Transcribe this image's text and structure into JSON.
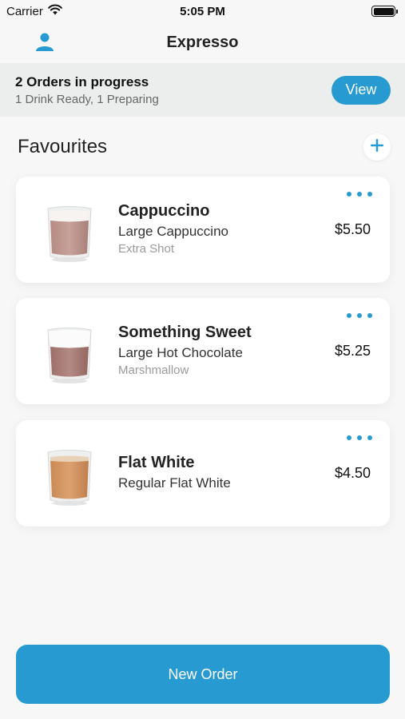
{
  "status_bar": {
    "carrier": "Carrier",
    "time": "5:05 PM"
  },
  "nav": {
    "title": "Expresso",
    "profile_icon": "person-icon"
  },
  "order_banner": {
    "title": "2 Orders in progress",
    "subtitle": "1 Drink Ready, 1 Preparing",
    "view_label": "View"
  },
  "favourites": {
    "title": "Favourites",
    "add_icon": "plus-icon",
    "items": [
      {
        "name": "Cappuccino",
        "description": "Large Cappuccino",
        "extra": "Extra Shot",
        "price": "$5.50",
        "cup": "cappuccino-cup-icon"
      },
      {
        "name": "Something Sweet",
        "description": "Large Hot Chocolate",
        "extra": "Marshmallow",
        "price": "$5.25",
        "cup": "hot-chocolate-cup-icon"
      },
      {
        "name": "Flat White",
        "description": "Regular Flat White",
        "extra": "",
        "price": "$4.50",
        "cup": "flat-white-cup-icon"
      }
    ]
  },
  "new_order_label": "New Order",
  "colors": {
    "accent": "#279bd1",
    "background": "#f7f7f7",
    "banner": "#eceeee"
  }
}
